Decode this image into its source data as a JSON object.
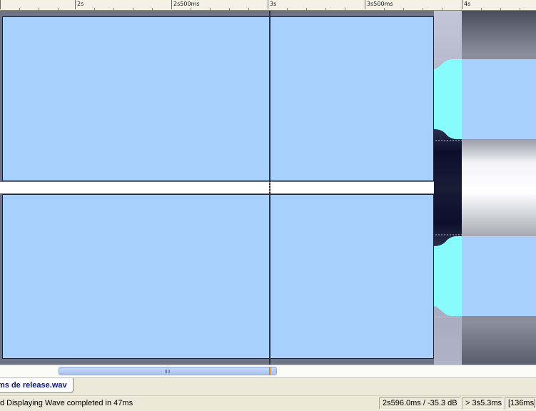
{
  "ruler": {
    "ticks": [
      "2s",
      "2s500ms",
      "3s",
      "3s500ms",
      "4s"
    ]
  },
  "tab": {
    "filename": "ms de release.wav"
  },
  "status": {
    "message": "d Displaying Wave completed in 47ms",
    "cursor": "2s596.0ms / -35.3 dB",
    "selection": "> 3s5.3ms",
    "duration": "[136ms]"
  },
  "colors": {
    "wave_fill": "#a8d0fc",
    "highlight": "#88fcfc",
    "background": "#6e7486",
    "cursor_line": "#26324a",
    "playhead_marker": "#d08838"
  },
  "icons": {
    "scroll_grip": "grip-icon"
  }
}
